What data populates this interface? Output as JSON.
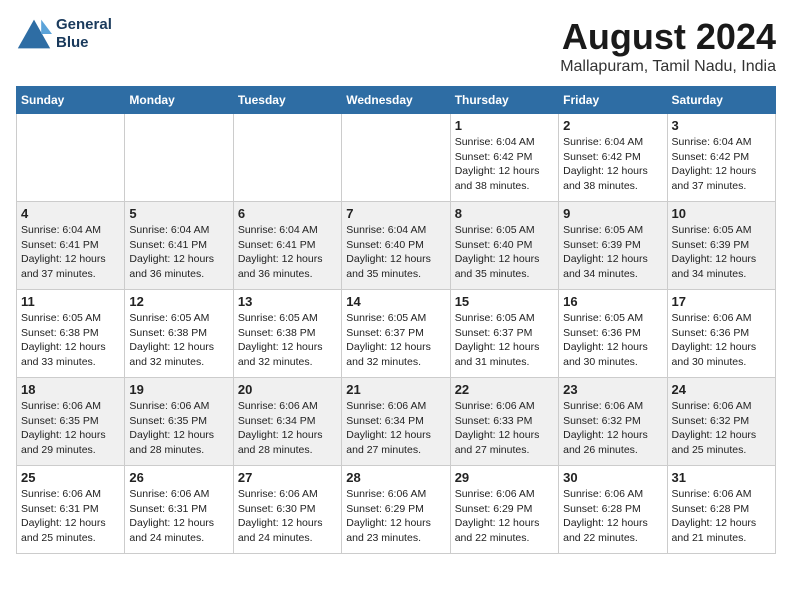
{
  "logo": {
    "line1": "General",
    "line2": "Blue"
  },
  "title": "August 2024",
  "subtitle": "Mallapuram, Tamil Nadu, India",
  "days_of_week": [
    "Sunday",
    "Monday",
    "Tuesday",
    "Wednesday",
    "Thursday",
    "Friday",
    "Saturday"
  ],
  "weeks": [
    [
      {
        "day": "",
        "info": ""
      },
      {
        "day": "",
        "info": ""
      },
      {
        "day": "",
        "info": ""
      },
      {
        "day": "",
        "info": ""
      },
      {
        "day": "1",
        "info": "Sunrise: 6:04 AM\nSunset: 6:42 PM\nDaylight: 12 hours\nand 38 minutes."
      },
      {
        "day": "2",
        "info": "Sunrise: 6:04 AM\nSunset: 6:42 PM\nDaylight: 12 hours\nand 38 minutes."
      },
      {
        "day": "3",
        "info": "Sunrise: 6:04 AM\nSunset: 6:42 PM\nDaylight: 12 hours\nand 37 minutes."
      }
    ],
    [
      {
        "day": "4",
        "info": "Sunrise: 6:04 AM\nSunset: 6:41 PM\nDaylight: 12 hours\nand 37 minutes."
      },
      {
        "day": "5",
        "info": "Sunrise: 6:04 AM\nSunset: 6:41 PM\nDaylight: 12 hours\nand 36 minutes."
      },
      {
        "day": "6",
        "info": "Sunrise: 6:04 AM\nSunset: 6:41 PM\nDaylight: 12 hours\nand 36 minutes."
      },
      {
        "day": "7",
        "info": "Sunrise: 6:04 AM\nSunset: 6:40 PM\nDaylight: 12 hours\nand 35 minutes."
      },
      {
        "day": "8",
        "info": "Sunrise: 6:05 AM\nSunset: 6:40 PM\nDaylight: 12 hours\nand 35 minutes."
      },
      {
        "day": "9",
        "info": "Sunrise: 6:05 AM\nSunset: 6:39 PM\nDaylight: 12 hours\nand 34 minutes."
      },
      {
        "day": "10",
        "info": "Sunrise: 6:05 AM\nSunset: 6:39 PM\nDaylight: 12 hours\nand 34 minutes."
      }
    ],
    [
      {
        "day": "11",
        "info": "Sunrise: 6:05 AM\nSunset: 6:38 PM\nDaylight: 12 hours\nand 33 minutes."
      },
      {
        "day": "12",
        "info": "Sunrise: 6:05 AM\nSunset: 6:38 PM\nDaylight: 12 hours\nand 32 minutes."
      },
      {
        "day": "13",
        "info": "Sunrise: 6:05 AM\nSunset: 6:38 PM\nDaylight: 12 hours\nand 32 minutes."
      },
      {
        "day": "14",
        "info": "Sunrise: 6:05 AM\nSunset: 6:37 PM\nDaylight: 12 hours\nand 32 minutes."
      },
      {
        "day": "15",
        "info": "Sunrise: 6:05 AM\nSunset: 6:37 PM\nDaylight: 12 hours\nand 31 minutes."
      },
      {
        "day": "16",
        "info": "Sunrise: 6:05 AM\nSunset: 6:36 PM\nDaylight: 12 hours\nand 30 minutes."
      },
      {
        "day": "17",
        "info": "Sunrise: 6:06 AM\nSunset: 6:36 PM\nDaylight: 12 hours\nand 30 minutes."
      }
    ],
    [
      {
        "day": "18",
        "info": "Sunrise: 6:06 AM\nSunset: 6:35 PM\nDaylight: 12 hours\nand 29 minutes."
      },
      {
        "day": "19",
        "info": "Sunrise: 6:06 AM\nSunset: 6:35 PM\nDaylight: 12 hours\nand 28 minutes."
      },
      {
        "day": "20",
        "info": "Sunrise: 6:06 AM\nSunset: 6:34 PM\nDaylight: 12 hours\nand 28 minutes."
      },
      {
        "day": "21",
        "info": "Sunrise: 6:06 AM\nSunset: 6:34 PM\nDaylight: 12 hours\nand 27 minutes."
      },
      {
        "day": "22",
        "info": "Sunrise: 6:06 AM\nSunset: 6:33 PM\nDaylight: 12 hours\nand 27 minutes."
      },
      {
        "day": "23",
        "info": "Sunrise: 6:06 AM\nSunset: 6:32 PM\nDaylight: 12 hours\nand 26 minutes."
      },
      {
        "day": "24",
        "info": "Sunrise: 6:06 AM\nSunset: 6:32 PM\nDaylight: 12 hours\nand 25 minutes."
      }
    ],
    [
      {
        "day": "25",
        "info": "Sunrise: 6:06 AM\nSunset: 6:31 PM\nDaylight: 12 hours\nand 25 minutes."
      },
      {
        "day": "26",
        "info": "Sunrise: 6:06 AM\nSunset: 6:31 PM\nDaylight: 12 hours\nand 24 minutes."
      },
      {
        "day": "27",
        "info": "Sunrise: 6:06 AM\nSunset: 6:30 PM\nDaylight: 12 hours\nand 24 minutes."
      },
      {
        "day": "28",
        "info": "Sunrise: 6:06 AM\nSunset: 6:29 PM\nDaylight: 12 hours\nand 23 minutes."
      },
      {
        "day": "29",
        "info": "Sunrise: 6:06 AM\nSunset: 6:29 PM\nDaylight: 12 hours\nand 22 minutes."
      },
      {
        "day": "30",
        "info": "Sunrise: 6:06 AM\nSunset: 6:28 PM\nDaylight: 12 hours\nand 22 minutes."
      },
      {
        "day": "31",
        "info": "Sunrise: 6:06 AM\nSunset: 6:28 PM\nDaylight: 12 hours\nand 21 minutes."
      }
    ]
  ],
  "colors": {
    "header_bg": "#2e6da4",
    "header_text": "#ffffff",
    "row_odd": "#ffffff",
    "row_even": "#f0f0f0"
  }
}
